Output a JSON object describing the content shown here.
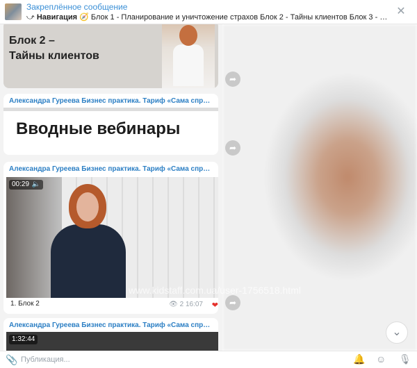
{
  "pinned": {
    "title": "Закреплённое сообщение",
    "nav_bold": "Навигация",
    "nav_text": "Блок 1 - Планирование и уничтожение страхов Блок 2 - Тайны клиентов Блок 3 - Предложени..."
  },
  "messages": [
    {
      "card_line1": "Блок 2 –",
      "card_line2": "Тайны клиентов"
    },
    {
      "author": "Александра Гуреева Бизнес практика. Тариф «Сама справлю...",
      "banner": "Вводные вебинары"
    },
    {
      "author": "Александра Гуреева Бизнес практика. Тариф «Сама справлю...",
      "duration": "00:29",
      "caption": "1. Блок 2",
      "views": "2",
      "time": "16:07"
    },
    {
      "author": "Александра Гуреева Бизнес практика. Тариф «Сама справлю...",
      "duration": "1:32:44"
    }
  ],
  "watermark": "www.kidstaff.com.ua/user-1756518.html",
  "composer": {
    "placeholder": "Публикация..."
  },
  "icons": {
    "close": "close-icon",
    "share": "share-icon",
    "speaker": "speaker-icon",
    "eye": "eye-icon",
    "heart": "heart-icon",
    "attach": "paperclip-icon",
    "bell": "bell-icon",
    "emoji": "emoji-icon",
    "mic": "microphone-icon",
    "chevron": "chevron-down-icon"
  },
  "colors": {
    "accent": "#2c7fc4",
    "heart": "#e5322d"
  }
}
